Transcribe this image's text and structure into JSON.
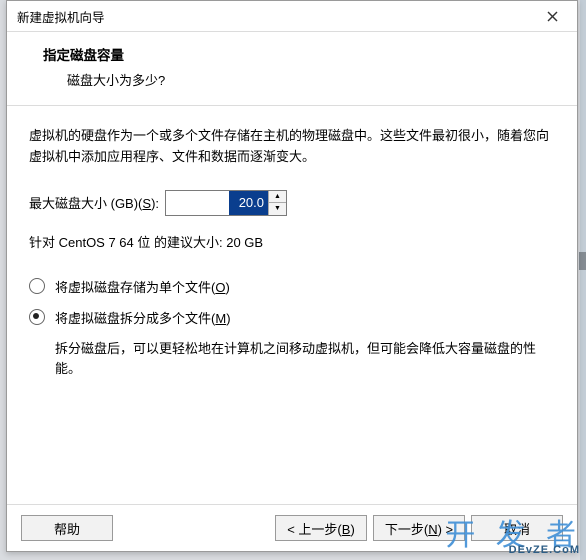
{
  "window": {
    "title": "新建虚拟机向导"
  },
  "header": {
    "title": "指定磁盘容量",
    "subtitle": "磁盘大小为多少?"
  },
  "body": {
    "intro": "虚拟机的硬盘作为一个或多个文件存储在主机的物理磁盘中。这些文件最初很小，随着您向虚拟机中添加应用程序、文件和数据而逐渐变大。",
    "size_label_pre": "最大磁盘大小 (GB)(",
    "size_label_hot": "S",
    "size_label_post": "):",
    "size_value": "20.0",
    "recommendation": "针对 CentOS 7 64 位 的建议大小: 20 GB",
    "opt_single_pre": "将虚拟磁盘存储为单个文件(",
    "opt_single_hot": "O",
    "opt_single_post": ")",
    "opt_split_pre": "将虚拟磁盘拆分成多个文件(",
    "opt_split_hot": "M",
    "opt_split_post": ")",
    "opt_split_note": "拆分磁盘后，可以更轻松地在计算机之间移动虚拟机，但可能会降低大容量磁盘的性能。"
  },
  "footer": {
    "help": "帮助",
    "back_pre": "< 上一步(",
    "back_hot": "B",
    "back_post": ")",
    "next_pre": "下一步(",
    "next_hot": "N",
    "next_post": ") >",
    "cancel": "取消"
  },
  "watermark": {
    "cn": "开 发 者",
    "en": "DEvZE.CoM"
  }
}
